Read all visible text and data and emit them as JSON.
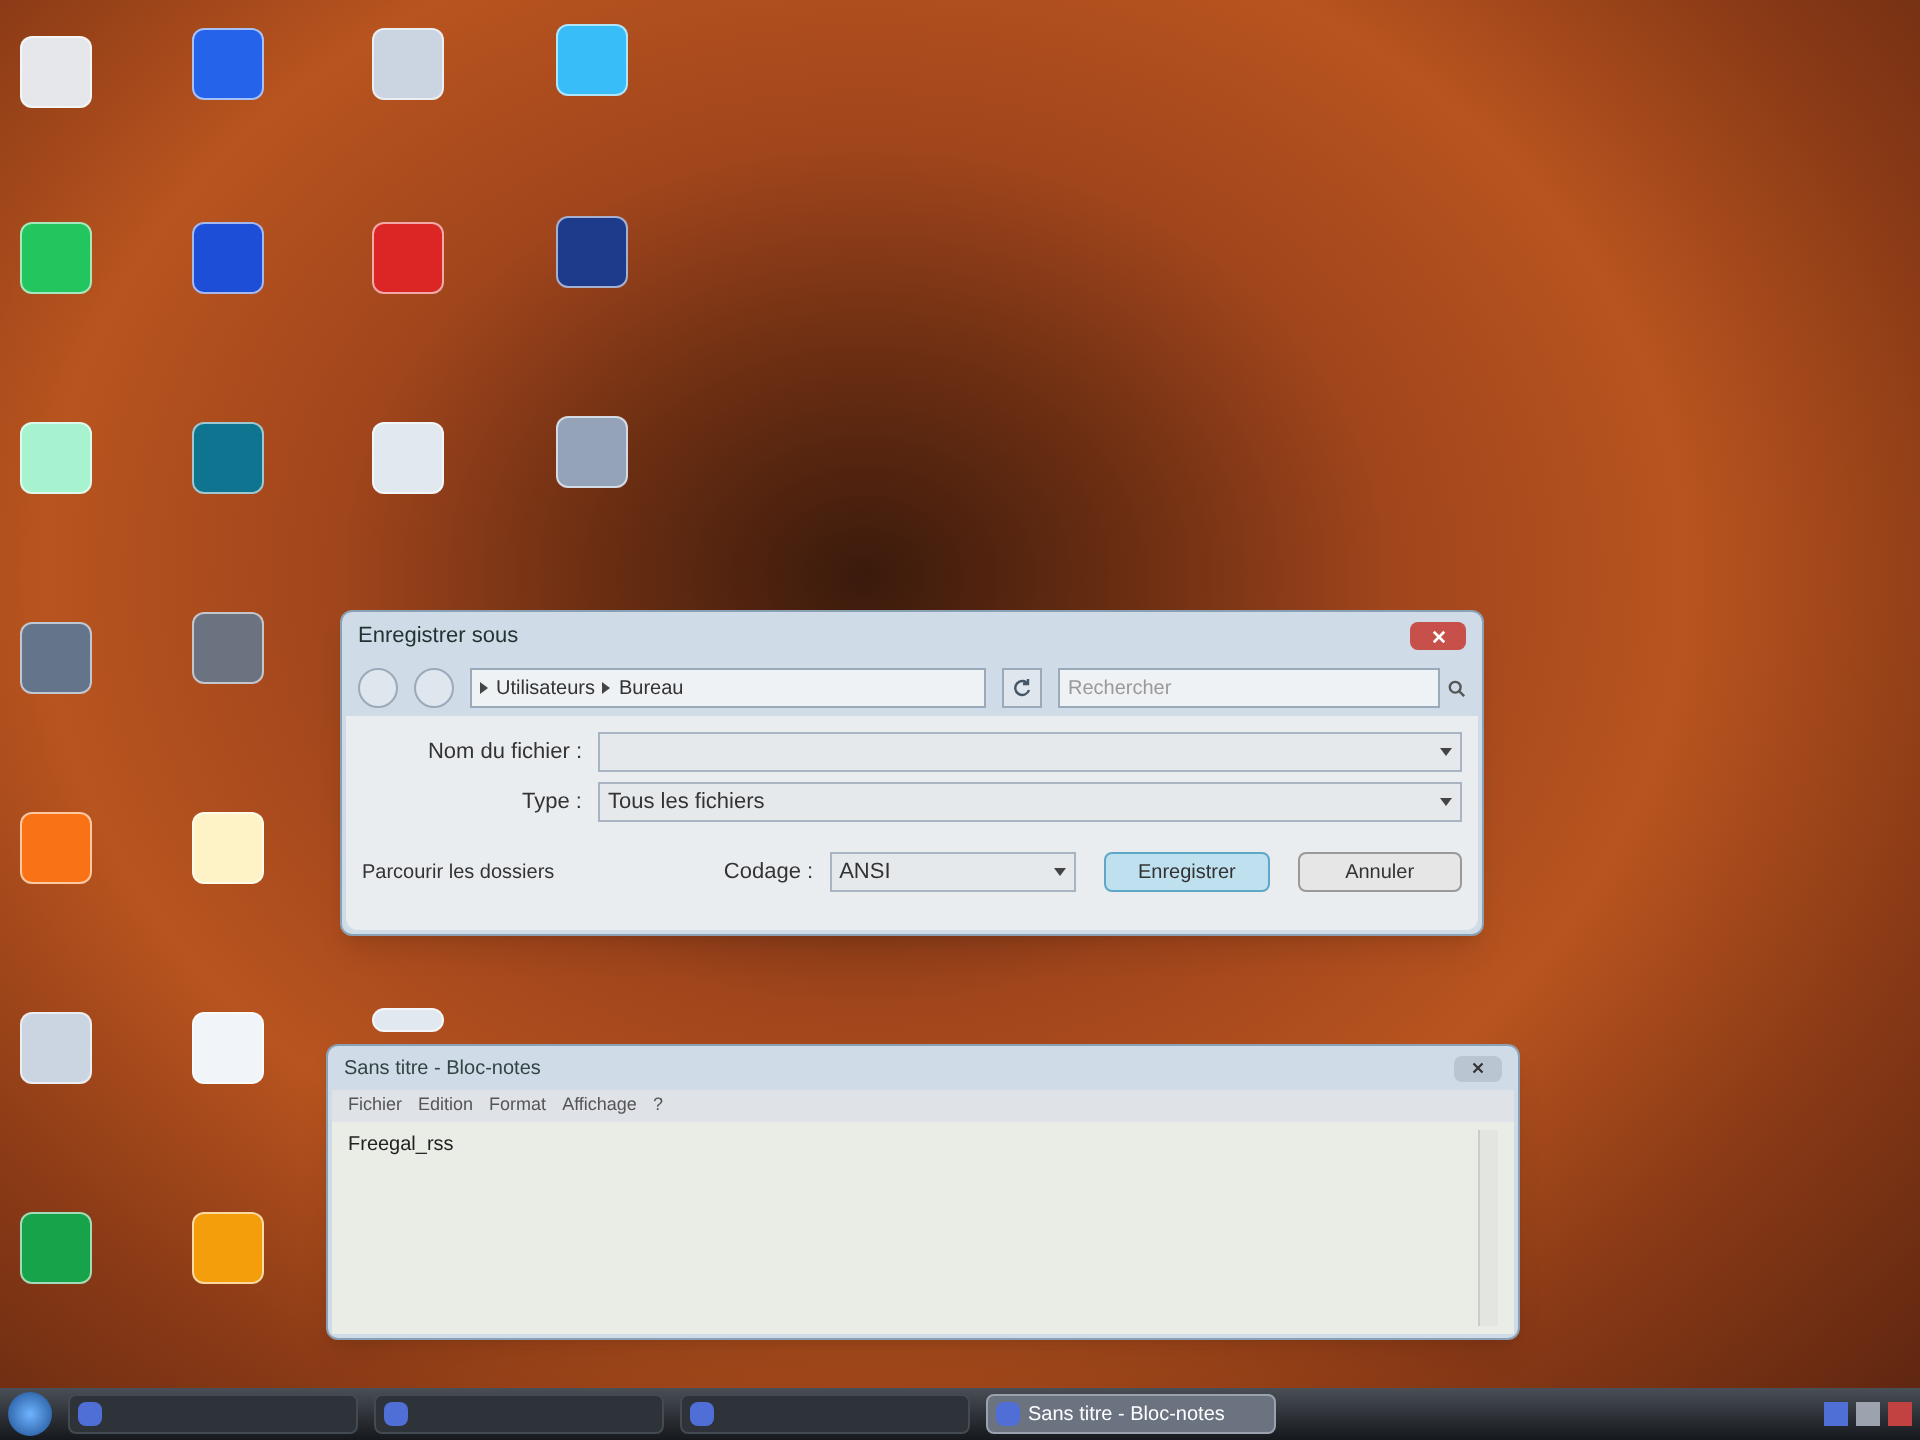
{
  "save_dialog": {
    "title": "Enregistrer sous",
    "breadcrumb": [
      "Utilisateurs",
      "Bureau"
    ],
    "search": {
      "placeholder": "Rechercher"
    },
    "filename": {
      "label": "Nom du fichier :"
    },
    "type": {
      "label": "Type :",
      "value": "Tous les fichiers"
    },
    "browse_folders": "Parcourir les dossiers",
    "encoding": {
      "label": "Codage :",
      "value": "ANSI"
    },
    "buttons": [
      "Enregistrer",
      "Annuler"
    ]
  },
  "notepad": {
    "title": "Sans titre - Bloc-notes",
    "menu": [
      "Fichier",
      "Edition",
      "Format",
      "Affichage",
      "?"
    ],
    "content": "Freegal_rss"
  },
  "taskbar": {
    "items": [
      {
        "kind": "app",
        "selected": false
      },
      {
        "kind": "app",
        "selected": false
      },
      {
        "kind": "app",
        "selected": false
      },
      {
        "kind": "app",
        "label": "Sans titre - Bloc-notes",
        "selected": true
      }
    ]
  }
}
